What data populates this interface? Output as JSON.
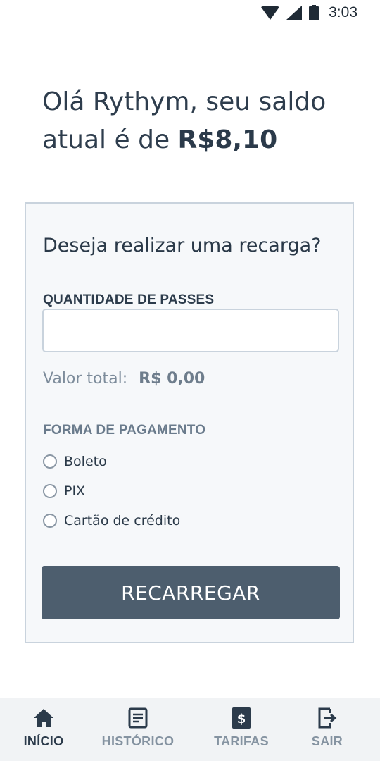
{
  "status_bar": {
    "time": "3:03",
    "icons": [
      "wifi-icon",
      "signal-icon",
      "battery-icon"
    ]
  },
  "greeting": {
    "text": "Olá Rythym, seu saldo atual é de ",
    "balance": "R$8,10"
  },
  "recharge_card": {
    "title": "Deseja realizar uma recarga?",
    "quantity_label": "QUANTIDADE DE PASSES",
    "quantity_value": "",
    "total_label": "Valor total:",
    "total_value": "R$ 0,00",
    "payment_label": "FORMA DE PAGAMENTO",
    "payment_options": [
      {
        "label": "Boleto",
        "selected": false
      },
      {
        "label": "PIX",
        "selected": false
      },
      {
        "label": "Cartão de crédito",
        "selected": false
      }
    ],
    "button_label": "RECARREGAR"
  },
  "bottom_nav": {
    "items": [
      {
        "label": "INÍCIO",
        "icon": "home-icon",
        "active": true
      },
      {
        "label": "HISTÓRICO",
        "icon": "document-icon",
        "active": false
      },
      {
        "label": "TARIFAS",
        "icon": "dollar-icon",
        "active": false
      },
      {
        "label": "SAIR",
        "icon": "logout-icon",
        "active": false
      }
    ]
  },
  "colors": {
    "primary_button": "#4d5e6e",
    "text_dark": "#2e3d4d",
    "card_background": "#f6f8fa",
    "card_border": "#c9d3dd",
    "nav_background": "#f1f3f5"
  }
}
